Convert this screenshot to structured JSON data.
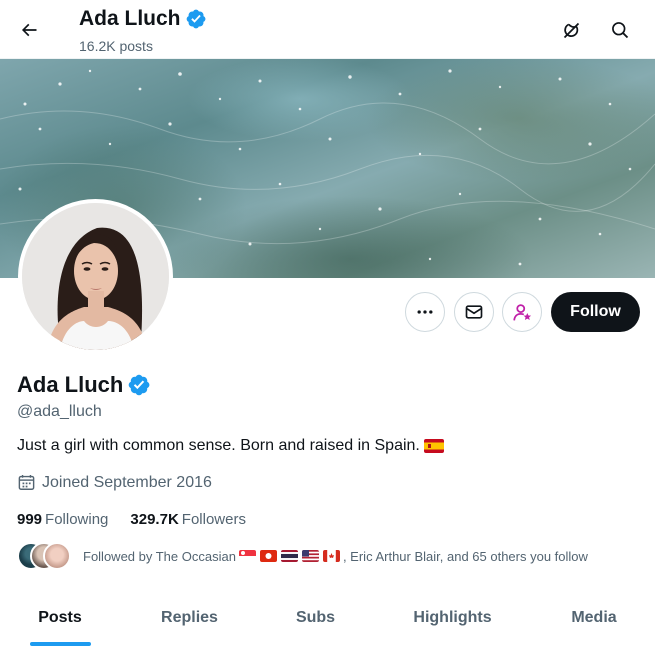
{
  "header": {
    "name": "Ada Lluch",
    "posts_count": "16.2K posts",
    "back_icon": "arrow-left-icon",
    "grok_icon": "grok-icon",
    "search_icon": "search-icon"
  },
  "profile": {
    "name": "Ada Lluch",
    "verified": true,
    "handle": "@ada_lluch",
    "bio": "Just a girl with common sense. Born and raised in Spain.",
    "joined": "Joined September 2016",
    "following_count": "999",
    "following_label": "Following",
    "followers_count": "329.7K",
    "followers_label": "Followers"
  },
  "actions": {
    "more_icon": "more-icon",
    "message_icon": "envelope-icon",
    "subscribe_icon": "person-star-icon",
    "follow_label": "Follow"
  },
  "followed_by": {
    "prefix": "Followed by The Occasian",
    "suffix": ", Eric Arthur Blair, and 65 others you follow"
  },
  "tabs": [
    {
      "label": "Posts",
      "active": true
    },
    {
      "label": "Replies",
      "active": false
    },
    {
      "label": "Subs",
      "active": false
    },
    {
      "label": "Highlights",
      "active": false
    },
    {
      "label": "Media",
      "active": false
    }
  ],
  "colors": {
    "accent": "#1d9bf0",
    "text": "#0f1419",
    "muted": "#536471",
    "follow_bg": "#0f1419",
    "subscribe": "#c01fa8"
  }
}
